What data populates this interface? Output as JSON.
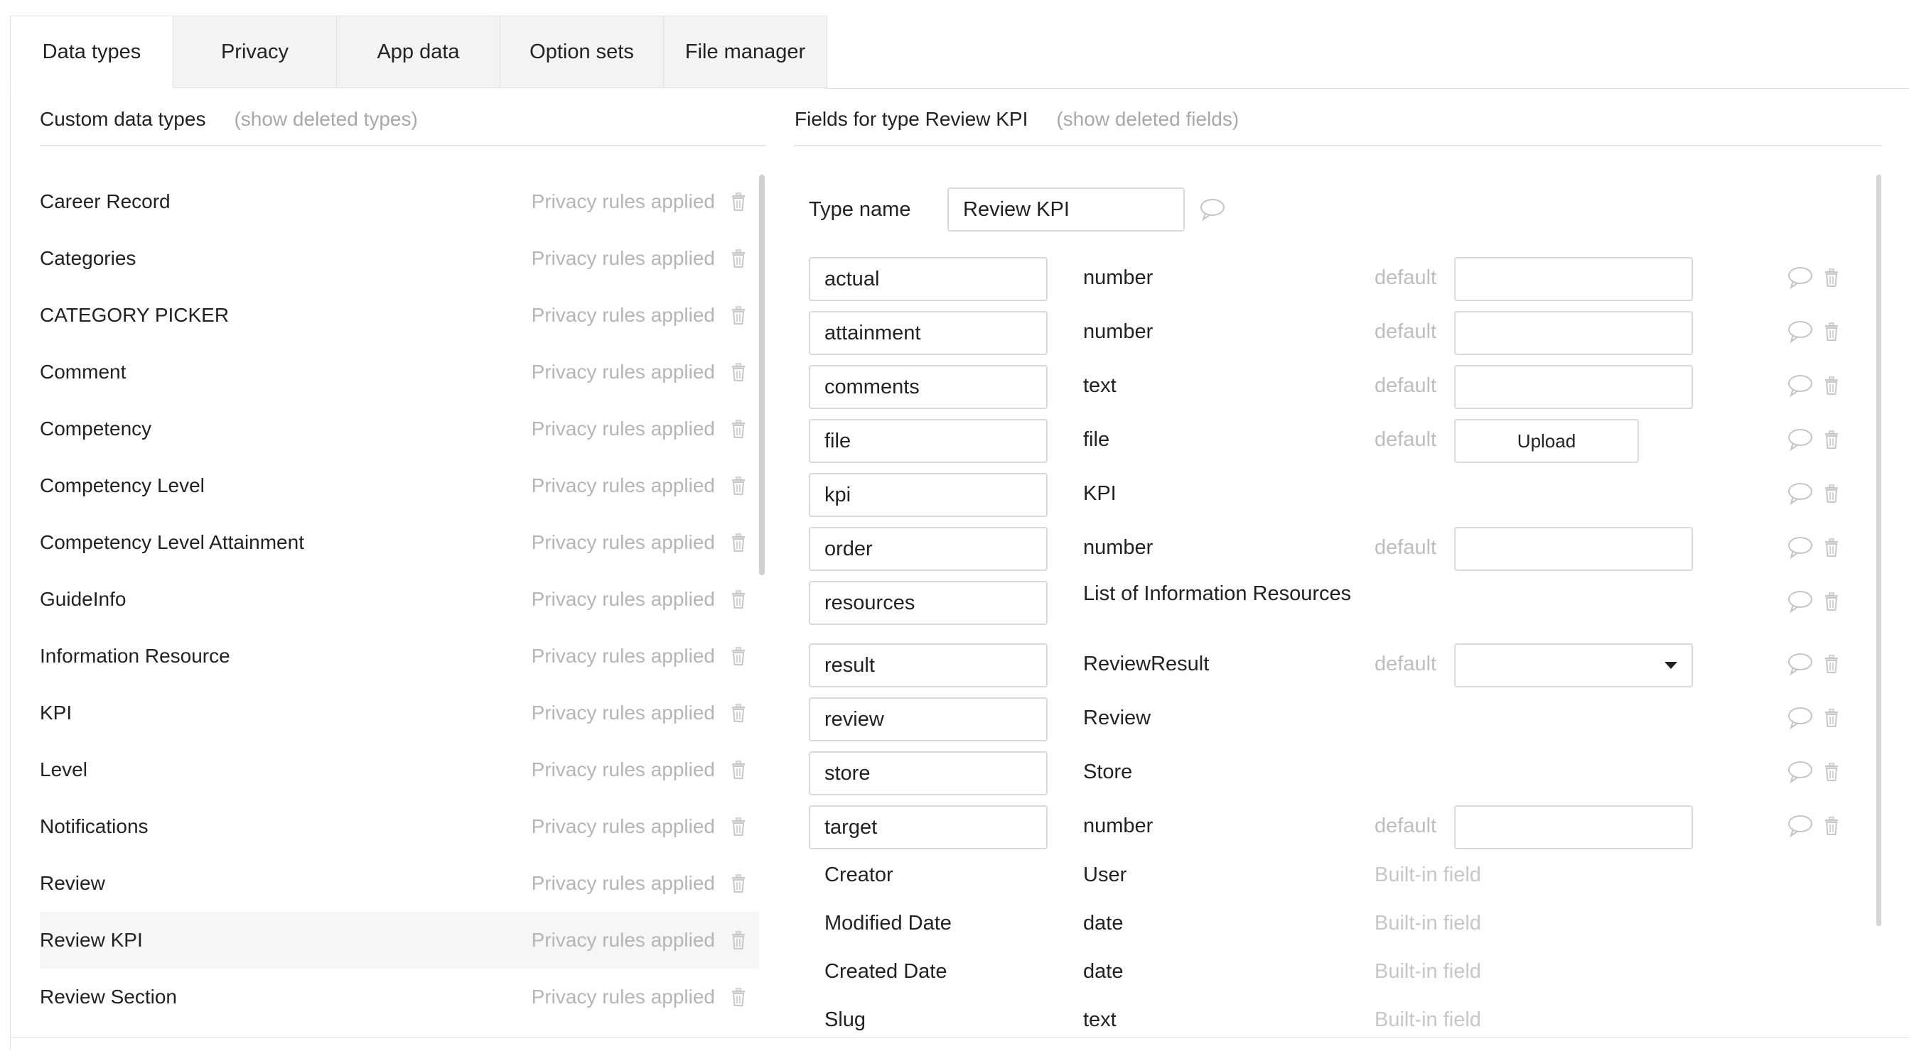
{
  "tabs": [
    "Data types",
    "Privacy",
    "App data",
    "Option sets",
    "File manager"
  ],
  "left_panel": {
    "title": "Custom data types",
    "show_deleted": "(show deleted types)",
    "types": [
      {
        "name": "Career Record",
        "privacy": "Privacy rules applied"
      },
      {
        "name": "Categories",
        "privacy": "Privacy rules applied"
      },
      {
        "name": "CATEGORY PICKER",
        "privacy": "Privacy rules applied"
      },
      {
        "name": "Comment",
        "privacy": "Privacy rules applied"
      },
      {
        "name": "Competency",
        "privacy": "Privacy rules applied"
      },
      {
        "name": "Competency Level",
        "privacy": "Privacy rules applied"
      },
      {
        "name": "Competency Level Attainment",
        "privacy": "Privacy rules applied"
      },
      {
        "name": "GuideInfo",
        "privacy": "Privacy rules applied"
      },
      {
        "name": "Information Resource",
        "privacy": "Privacy rules applied"
      },
      {
        "name": "KPI",
        "privacy": "Privacy rules applied"
      },
      {
        "name": "Level",
        "privacy": "Privacy rules applied"
      },
      {
        "name": "Notifications",
        "privacy": "Privacy rules applied"
      },
      {
        "name": "Review",
        "privacy": "Privacy rules applied"
      },
      {
        "name": "Review KPI",
        "privacy": "Privacy rules applied",
        "selected": true
      },
      {
        "name": "Review Section",
        "privacy": "Privacy rules applied"
      }
    ]
  },
  "right_panel": {
    "title": "Fields for type Review KPI",
    "show_deleted": "(show deleted fields)",
    "type_name_label": "Type name",
    "type_name_value": "Review KPI",
    "default_label": "default",
    "upload_label": "Upload",
    "fields": [
      {
        "name": "actual",
        "type": "number",
        "default": "input"
      },
      {
        "name": "attainment",
        "type": "number",
        "default": "input"
      },
      {
        "name": "comments",
        "type": "text",
        "default": "input"
      },
      {
        "name": "file",
        "type": "file",
        "default": "upload"
      },
      {
        "name": "kpi",
        "type": "KPI",
        "default": "none"
      },
      {
        "name": "order",
        "type": "number",
        "default": "input"
      },
      {
        "name": "resources",
        "type": "List of Information Resources",
        "default": "none"
      },
      {
        "name": "result",
        "type": "ReviewResult",
        "default": "select"
      },
      {
        "name": "review",
        "type": "Review",
        "default": "none"
      },
      {
        "name": "store",
        "type": "Store",
        "default": "none"
      },
      {
        "name": "target",
        "type": "number",
        "default": "input"
      }
    ],
    "builtin_fields": [
      {
        "name": "Creator",
        "type": "User",
        "note": "Built-in field"
      },
      {
        "name": "Modified Date",
        "type": "date",
        "note": "Built-in field"
      },
      {
        "name": "Created Date",
        "type": "date",
        "note": "Built-in field"
      },
      {
        "name": "Slug",
        "type": "text",
        "note": "Built-in field"
      }
    ]
  },
  "icons": {
    "delete": "trash-icon",
    "comment": "comment-bubble-icon",
    "dropdown": "caret-down-icon"
  }
}
